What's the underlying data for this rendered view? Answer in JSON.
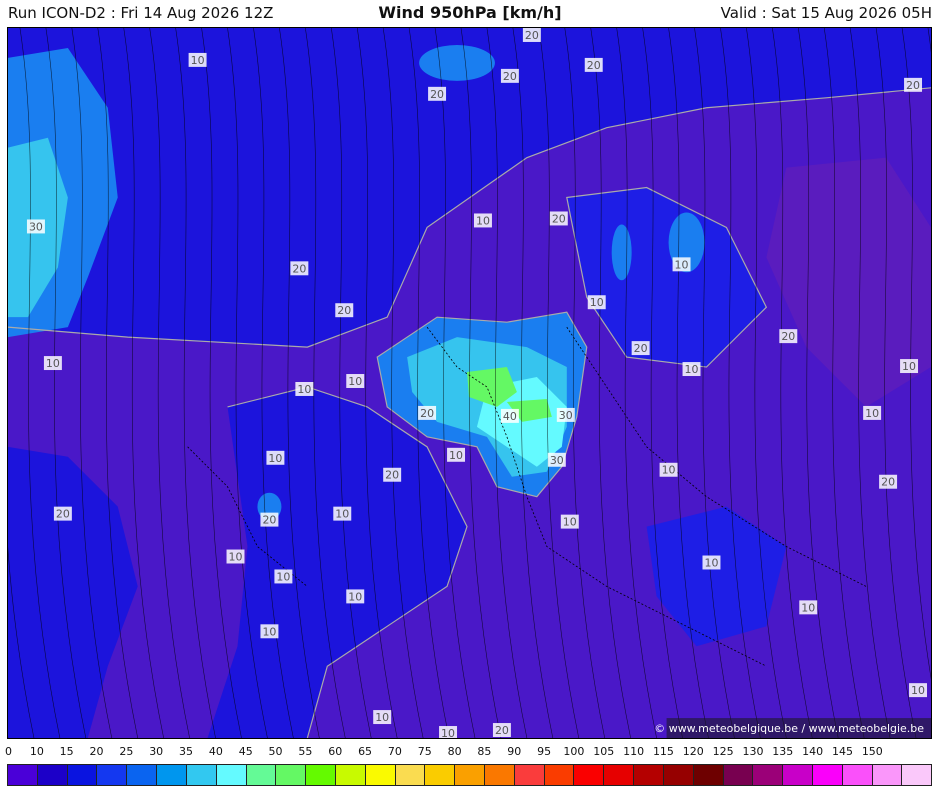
{
  "header": {
    "run": "Run ICON-D2 : Fri 14 Aug 2026 12Z",
    "title": "Wind 950hPa [km/h]",
    "valid": "Valid : Sat 15 Aug 2026 05H"
  },
  "map": {
    "credit": "© www.meteobelgique.be / www.meteobelgie.be",
    "contour_labels": [
      "10",
      "20",
      "20",
      "20",
      "20",
      "20",
      "10",
      "20",
      "30",
      "20",
      "10",
      "10",
      "20",
      "20",
      "20",
      "10",
      "10",
      "10",
      "10",
      "10",
      "20",
      "40",
      "30",
      "10",
      "20",
      "30",
      "10",
      "20",
      "10",
      "10",
      "10",
      "10",
      "20",
      "10",
      "10",
      "10",
      "10",
      "10",
      "10",
      "10",
      "10",
      "20",
      "20",
      "10"
    ]
  },
  "scale": {
    "ticks": [
      "0",
      "10",
      "15",
      "20",
      "25",
      "30",
      "35",
      "40",
      "45",
      "50",
      "55",
      "60",
      "65",
      "70",
      "75",
      "80",
      "85",
      "90",
      "95",
      "100",
      "105",
      "110",
      "115",
      "120",
      "125",
      "130",
      "135",
      "140",
      "145",
      "150"
    ],
    "colors": [
      "#4a00d8",
      "#1c00c8",
      "#0a14e0",
      "#1438f0",
      "#0a64f0",
      "#0096ee",
      "#32c8f0",
      "#64faff",
      "#64fa96",
      "#64f864",
      "#64fa00",
      "#c8fa00",
      "#fafa00",
      "#fadc50",
      "#facc00",
      "#faa000",
      "#fa7800",
      "#fa3c3c",
      "#fa3c00",
      "#fa0000",
      "#e60000",
      "#b40000",
      "#960000",
      "#6e0000",
      "#780050",
      "#9b0078",
      "#c800c8",
      "#fa00fa",
      "#fa50fa",
      "#fa96fa",
      "#fac8fa"
    ]
  }
}
